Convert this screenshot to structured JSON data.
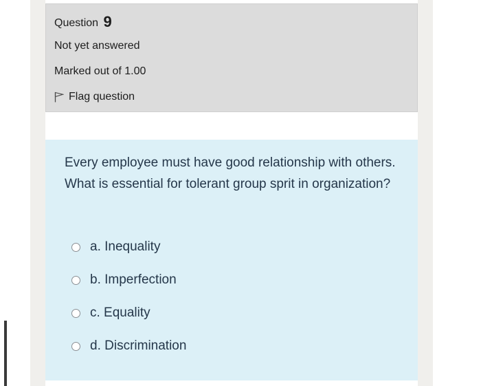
{
  "question": {
    "label": "Question",
    "number": "9",
    "state": "Not yet answered",
    "grade": "Marked out of 1.00",
    "flag_label": "Flag question",
    "flag_icon": "flag-icon",
    "text": "Every employee must have good relationship with others. What is essential for tolerant group sprit in organization?"
  },
  "answers": [
    {
      "label": "a. Inequality"
    },
    {
      "label": "b. Imperfection"
    },
    {
      "label": "c. Equality"
    },
    {
      "label": "d. Discrimination"
    }
  ],
  "colors": {
    "info_background": "#dcdcdc",
    "question_background": "#dcf0f7",
    "text": "#25374a"
  }
}
